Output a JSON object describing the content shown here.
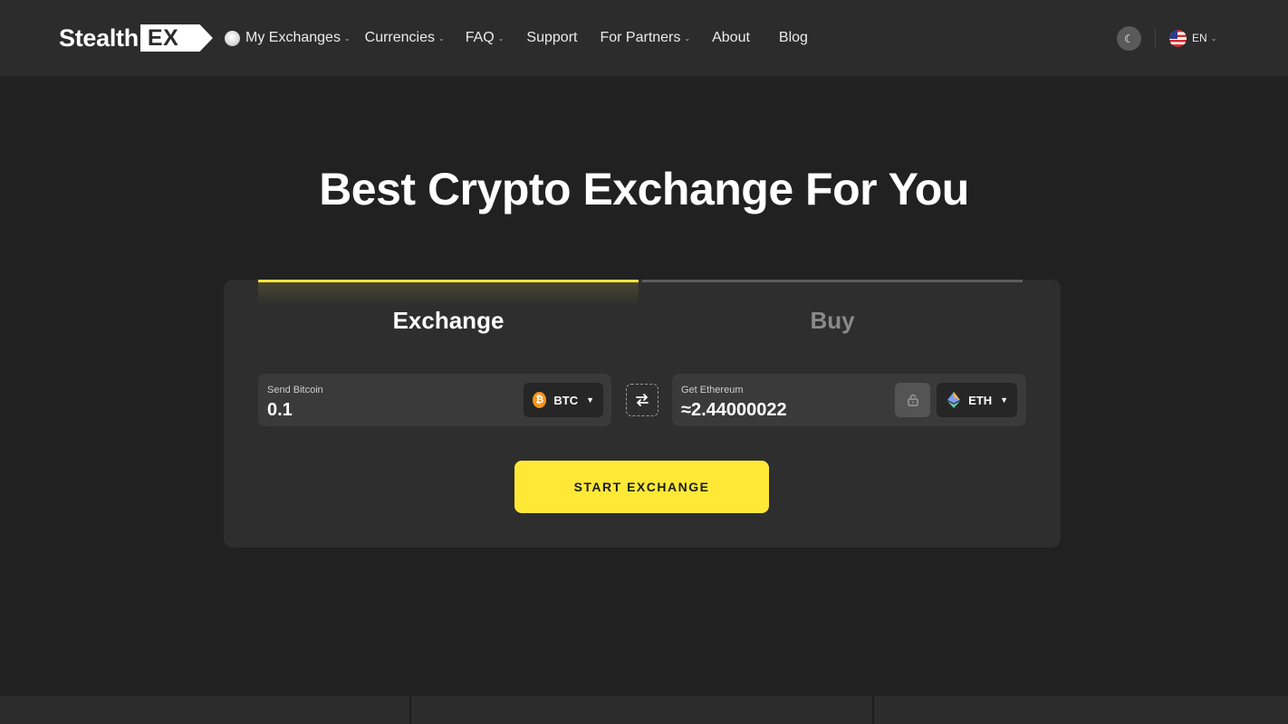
{
  "brand": {
    "logo_text": "Stealth",
    "logo_badge": "EX"
  },
  "nav": {
    "items": [
      {
        "label": "My Exchanges",
        "has_dropdown": true
      },
      {
        "label": "Currencies",
        "has_dropdown": true
      },
      {
        "label": "FAQ",
        "has_dropdown": true
      },
      {
        "label": "Support",
        "has_dropdown": false
      },
      {
        "label": "For Partners",
        "has_dropdown": true
      },
      {
        "label": "About",
        "has_dropdown": false
      },
      {
        "label": "Blog",
        "has_dropdown": false
      }
    ],
    "theme_icon": "moon-icon",
    "language": {
      "code": "EN",
      "flag": "us-flag-icon"
    }
  },
  "hero": {
    "title": "Best Crypto Exchange For You"
  },
  "widget": {
    "tabs": [
      {
        "label": "Exchange",
        "active": true
      },
      {
        "label": "Buy",
        "active": false
      }
    ],
    "send": {
      "label": "Send Bitcoin",
      "value": "0.1",
      "currency": "BTC",
      "icon": "bitcoin-icon"
    },
    "get": {
      "label": "Get Ethereum",
      "value": "≈2.44000022",
      "currency": "ETH",
      "icon": "ethereum-icon"
    },
    "swap_icon": "swap-arrows-icon",
    "lock_icon": "unlock-icon",
    "submit_label": "START EXCHANGE"
  },
  "colors": {
    "accent": "#ffe936",
    "background": "#212121",
    "header": "#2c2c2c",
    "card": "#2e2e2e",
    "btc": "#f7931a"
  }
}
